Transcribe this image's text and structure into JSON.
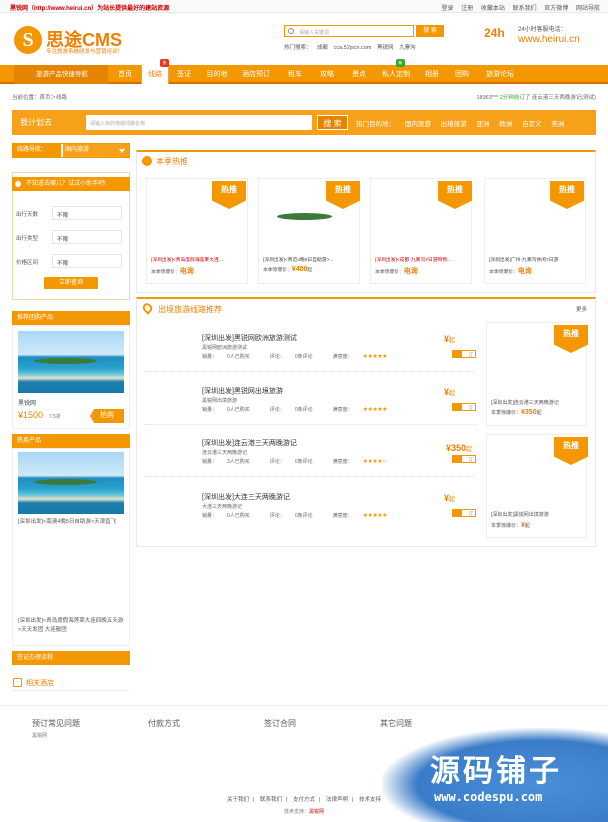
{
  "topbar": {
    "slogan": "黑锐网（http://www.heirui.cn）为站长提供最好的建站资源",
    "links": [
      "登录",
      "注册",
      "收藏本站",
      "联系我们",
      "官方微博",
      "网站导航"
    ]
  },
  "logo": {
    "mark": "S",
    "name": "思途CMS",
    "tagline": "专注旅游系统研发与营销培训！"
  },
  "search": {
    "placeholder": "请输入关键词",
    "button": "搜 索"
  },
  "hot_search": {
    "label": "热门搜索：",
    "items": [
      "成都",
      "cca.52jscn.com",
      "黑锐网",
      "九寨沟"
    ]
  },
  "hotline": {
    "badge": "24h",
    "label": "24小时客服电话：",
    "url": "www.heirui.cn"
  },
  "nav": {
    "category": "旅游产品快捷导航",
    "items": [
      "首页",
      "线路",
      "签证",
      "目的地",
      "酒店预订",
      "租车",
      "攻略",
      "景点",
      "私人定制",
      "相册",
      "团购",
      "旅游论坛"
    ],
    "badges": [
      "热",
      "新"
    ]
  },
  "breadcrumb": {
    "label": "当前位置：",
    "home": "首页",
    "sep": "＞",
    "current": "线路"
  },
  "breadcrumb_right": {
    "prefix": "18963***",
    "action": "2分钟前订了",
    "item": "连云港三天两晚游记(测试)"
  },
  "planbar": {
    "label": "我计划去",
    "placeholder": "请输入目的地或线路名称",
    "button": "搜 索",
    "hot_label": "热门目的地：",
    "destinations": [
      "国内旅游",
      "出境旅游",
      "亚洲",
      "欧洲",
      "自定义",
      "美洲"
    ]
  },
  "sidebar": {
    "nav_label": "线路导航：",
    "nav_value": "国内旅游",
    "filter_title": "不知道去哪儿？试试小助手吧!",
    "filters": [
      {
        "key": "出行天数",
        "value": "不限"
      },
      {
        "key": "出行类型",
        "value": "不限"
      },
      {
        "key": "价格区间",
        "value": "不限"
      }
    ],
    "query_button": "立即查询",
    "group_title": "推荐团购产品",
    "group_item": {
      "name": "黑锐网",
      "price": "¥1500",
      "discount": "7.5折",
      "button": "抢购"
    },
    "hot_title": "热卖产品",
    "hot_item_1": "[深圳出发]<南澳4晚5日自助游>天津直飞",
    "hot_item_2": "[深圳出发]<青岛度假海莲莱大连四晚五天游>天天发团 大连散团",
    "visa_title": "签证办理流程",
    "hotel_title": "相关酒店"
  },
  "season": {
    "title": "本季热推",
    "tag": "热推",
    "price_label": "本季惊爆价：",
    "cards": [
      {
        "title": "[深圳出发]<青岛度假海莲莱大连...",
        "price": "电询",
        "has_image": false
      },
      {
        "title": "[深圳出发]<青迈4晚5日自助游>...",
        "price": "¥400",
        "unit": "起",
        "has_image": true
      },
      {
        "title": "[深圳出发]<成都-九寨沟7日游购物...",
        "price": "电询",
        "has_image": false
      },
      {
        "title": "[深圳出发]广州-九寨沟休闲7日游",
        "price": "电询",
        "has_image": false
      }
    ]
  },
  "outbound": {
    "title": "出境旅游线路推荐",
    "more": "更多",
    "sales_label": "销量：",
    "comment_label": "评论：",
    "satisfy_label": "满意度：",
    "book_label": "订",
    "routes": [
      {
        "name": "[深圳出发]黑锐网欧洲旅游测试",
        "sub": "黑锐网欧洲旅游测试",
        "sales": "0人已购买",
        "comments": "0条评论",
        "stars": "★★★★★",
        "price": "¥",
        "unit": "起"
      },
      {
        "name": "[深圳出发]黑锐网出境旅游",
        "sub": "黑锐网出境旅游",
        "sales": "0人已购买",
        "comments": "0条评论",
        "stars": "★★★★★",
        "price": "¥",
        "unit": "起"
      },
      {
        "name": "[深圳出发]连云港三天两晚游记",
        "sub": "连云港三天两晚游记",
        "sales": "3人已购买",
        "comments": "0条评论",
        "stars": "★★★★☆",
        "price": "¥350",
        "unit": "起"
      },
      {
        "name": "[深圳出发]大连三天两晚游记",
        "sub": "大连三天两晚游记",
        "sales": "0人已购买",
        "comments": "0条评论",
        "stars": "★★★★★",
        "price": "¥",
        "unit": "起"
      }
    ],
    "side_cards": [
      {
        "title": "[深圳出发]连云港三天两晚游记",
        "price": "¥350",
        "unit": "起"
      },
      {
        "title": "[深圳出发]黑锐网出境旅游",
        "price": "¥",
        "unit": "起"
      }
    ]
  },
  "footer": {
    "columns": [
      "预订常见问题",
      "付款方式",
      "签订合同",
      "其它问题"
    ],
    "col1_sub": "黑锐网",
    "links": [
      "关于我们",
      "联系我们",
      "支付方式",
      "法律声明",
      "技术支持"
    ],
    "tech_label": "技术支持：",
    "tech_value": "黑锐网"
  },
  "watermark": {
    "cn": "源码铺子",
    "en": "www.codespu.com"
  },
  "colors": {
    "accent": "#f39800",
    "accent_dark": "#e68400",
    "price": "#ef7f00",
    "sea": "#1f8ec0"
  }
}
